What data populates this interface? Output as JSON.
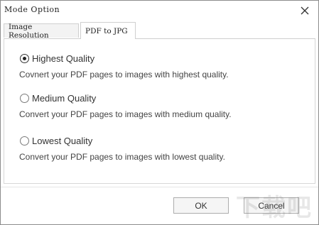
{
  "window": {
    "title": "Mode Option",
    "close_icon": "close-icon"
  },
  "tabs": [
    {
      "label": "Image Resolution",
      "active": false
    },
    {
      "label": "PDF to JPG",
      "active": true
    }
  ],
  "options": [
    {
      "label": "Highest Quality",
      "description": "Covnert your PDF pages to images with highest quality.",
      "selected": true
    },
    {
      "label": "Medium Quality",
      "description": "Convert your PDF pages to images with medium quality.",
      "selected": false
    },
    {
      "label": "Lowest Quality",
      "description": "Convert your PDF pages to images with lowest quality.",
      "selected": false
    }
  ],
  "buttons": {
    "ok_label": "OK",
    "cancel_label": "Cancel"
  },
  "watermark": {
    "text": "下载吧"
  }
}
